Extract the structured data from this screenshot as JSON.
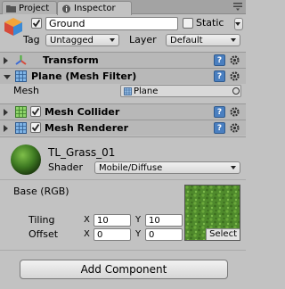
{
  "tabs": [
    {
      "label": "Project",
      "icon": "project-folder-icon",
      "active": false
    },
    {
      "label": "Inspector",
      "icon": "inspector-info-icon",
      "active": true
    }
  ],
  "header": {
    "name": "Ground",
    "static_label": "Static",
    "tag_label": "Tag",
    "tag_value": "Untagged",
    "layer_label": "Layer",
    "layer_value": "Default"
  },
  "components": {
    "transform": {
      "title": "Transform",
      "icon": "transform-axes-icon"
    },
    "mesh_filter": {
      "title": "Plane (Mesh Filter)",
      "icon": "mesh-grid-icon",
      "mesh_label": "Mesh",
      "mesh_value": "Plane"
    },
    "mesh_collider": {
      "title": "Mesh Collider",
      "icon": "mesh-collider-icon"
    },
    "mesh_renderer": {
      "title": "Mesh Renderer",
      "icon": "mesh-renderer-icon"
    }
  },
  "material": {
    "name": "TL_Grass_01",
    "shader_label": "Shader",
    "shader_value": "Mobile/Diffuse",
    "base_label": "Base (RGB)",
    "tiling_label": "Tiling",
    "offset_label": "Offset",
    "x_label": "X",
    "y_label": "Y",
    "tiling_x": "10",
    "tiling_y": "10",
    "offset_x": "0",
    "offset_y": "0",
    "select_label": "Select"
  },
  "add_component_label": "Add Component",
  "colors": {
    "panel_bg": "#c2c2c2",
    "help_blue": "#4a7fc0",
    "grass_green": "#4f8a2c"
  }
}
